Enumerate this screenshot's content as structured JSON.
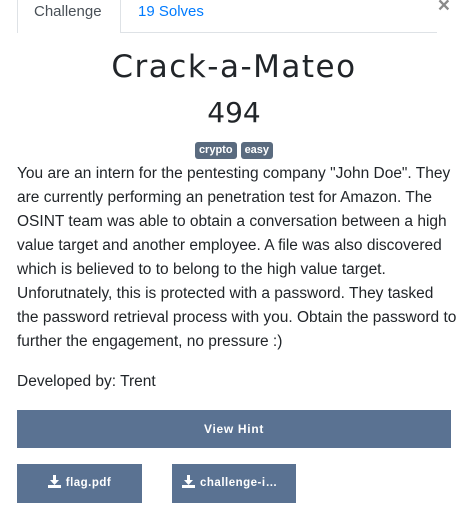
{
  "tabs": [
    {
      "label": "Challenge"
    },
    {
      "label": "19 Solves"
    }
  ],
  "close_symbol": "×",
  "challenge": {
    "name": "Crack-a-Mateo",
    "points": "494",
    "tags": [
      "crypto",
      "easy"
    ],
    "description": "You are an intern for the pentesting company \"John Doe\". They are currently performing an penetration test for Amazon. The OSINT team was able to obtain a conversation between a high value target and another employee. A file was also discovered which is believed to to belong to the high value target. Unforutnately, this is protected with a password. They tasked the password retrieval process with you. Obtain the password to further the engagement, no pressure :)",
    "developer": "Developed by: Trent"
  },
  "buttons": {
    "hint": "View Hint",
    "files": [
      "flag.pdf",
      "challenge-im..."
    ]
  },
  "colors": {
    "button": "#5a7292",
    "tag": "#5a6b7f",
    "link": "#007bff"
  },
  "icons": [
    "download-icon",
    "close-icon"
  ]
}
